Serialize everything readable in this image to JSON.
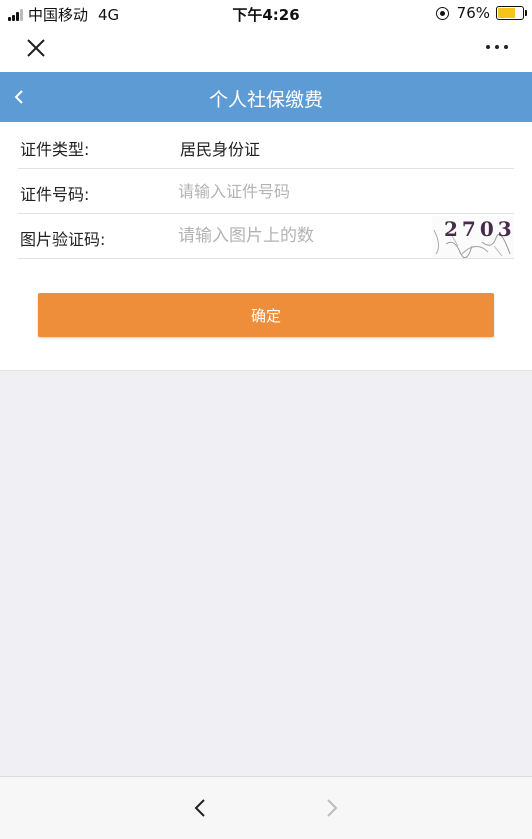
{
  "status_bar": {
    "carrier": "中国移动",
    "network": "4G",
    "time": "下午4:26",
    "battery_percent": "76%",
    "battery_level": 0.76,
    "icons": [
      "signal-icon",
      "rotation-lock-icon",
      "battery-icon"
    ]
  },
  "window": {
    "close_icon": "close-icon",
    "more_icon": "more-icon"
  },
  "nav": {
    "title": "个人社保缴费",
    "back_icon": "chevron-left-icon",
    "color": "#5d9bd5"
  },
  "form": {
    "id_type_label": "证件类型:",
    "id_type_value": "居民身份证",
    "id_number_label": "证件号码:",
    "id_number_placeholder": "请输入证件号码",
    "captcha_label": "图片验证码:",
    "captcha_placeholder": "请输入图片上的数",
    "captcha_image_text": "2703"
  },
  "confirm_button": {
    "label": "确定",
    "color": "#ee8d3a"
  },
  "bottom_nav": {
    "back_icon": "chevron-left-icon",
    "forward_icon": "chevron-right-icon"
  }
}
